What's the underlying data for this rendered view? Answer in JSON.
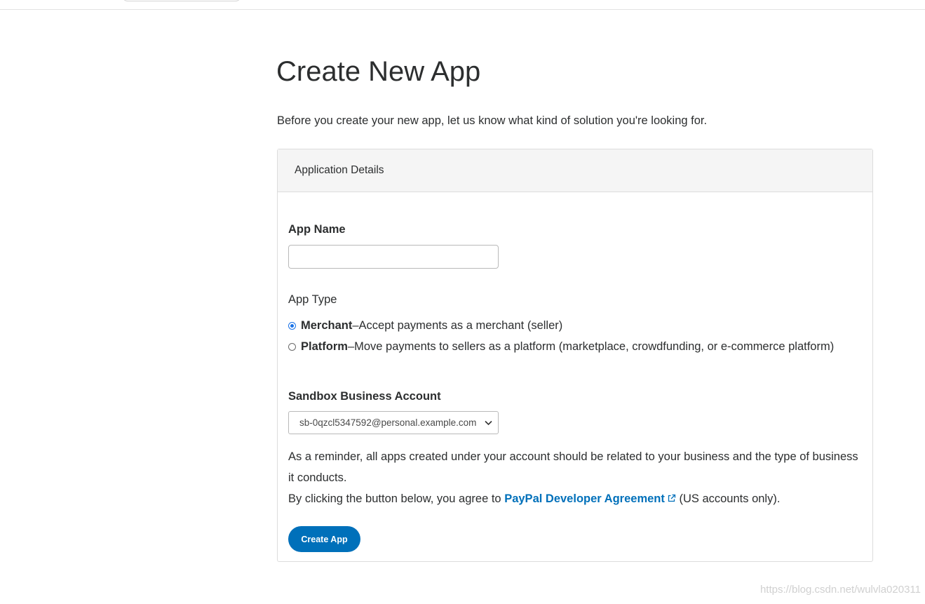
{
  "page": {
    "title": "Create New App",
    "intro": "Before you create your new app, let us know what kind of solution you're looking for."
  },
  "card": {
    "header": "Application Details",
    "app_name": {
      "label": "App Name",
      "value": "",
      "placeholder": ""
    },
    "app_type": {
      "label": "App Type",
      "options": [
        {
          "name": "Merchant",
          "sep": " – ",
          "desc": "Accept payments as a merchant (seller)",
          "checked": true
        },
        {
          "name": "Platform",
          "sep": " – ",
          "desc": "Move payments to sellers as a platform (marketplace, crowdfunding, or e-commerce platform)",
          "checked": false
        }
      ]
    },
    "sandbox": {
      "label": "Sandbox Business Account",
      "selected": "sb-0qzcl5347592@personal.example.com"
    },
    "reminder": "As a reminder, all apps created under your account should be related to your business and the type of business it conducts.",
    "agreement": {
      "prefix": "By clicking the button below, you agree to ",
      "link": "PayPal Developer Agreement",
      "suffix": " (US accounts only)."
    },
    "button": "Create App"
  },
  "watermark": "https://blog.csdn.net/wulvla020311",
  "colors": {
    "accent": "#0070ba",
    "radio": "#1a73e8"
  },
  "icons": {
    "external": "external-link-icon",
    "dropdown": "chevron-down-icon"
  }
}
